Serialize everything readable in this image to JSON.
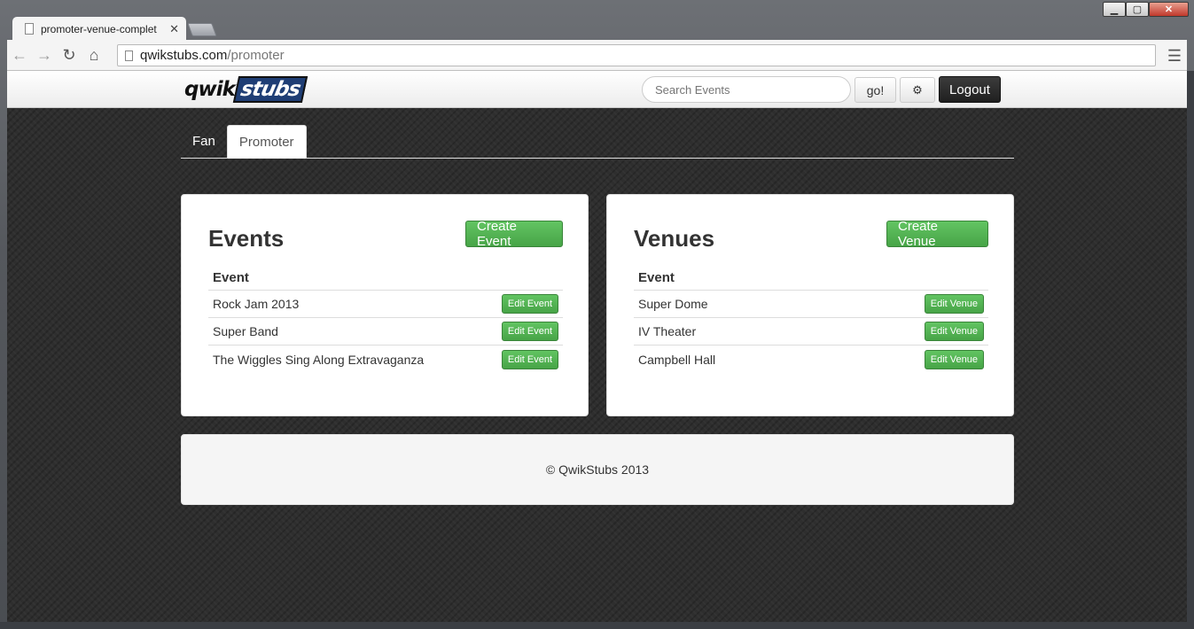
{
  "browser": {
    "tab_title": "promoter-venue-complet",
    "tab_close": "✕",
    "url_host": "qwikstubs.com",
    "url_path": "/promoter",
    "window_controls": {
      "minimize": "▁",
      "maximize": "▢",
      "close": "✕"
    }
  },
  "navbar": {
    "logo_part1": "qwik",
    "logo_part2": "stubs",
    "search_placeholder": "Search Events",
    "go_label": "go!",
    "settings_icon": "gear-icon",
    "logout_label": "Logout"
  },
  "page_tabs": [
    {
      "label": "Fan",
      "active": false
    },
    {
      "label": "Promoter",
      "active": true
    }
  ],
  "events_card": {
    "title": "Events",
    "create_label": "Create Event",
    "column_header": "Event",
    "rows": [
      {
        "name": "Rock Jam 2013",
        "action": "Edit Event"
      },
      {
        "name": "Super Band",
        "action": "Edit Event"
      },
      {
        "name": "The Wiggles Sing Along Extravaganza",
        "action": "Edit Event"
      }
    ]
  },
  "venues_card": {
    "title": "Venues",
    "create_label": "Create Venue",
    "column_header": "Event",
    "rows": [
      {
        "name": "Super Dome",
        "action": "Edit Venue"
      },
      {
        "name": "IV Theater",
        "action": "Edit Venue"
      },
      {
        "name": "Campbell Hall",
        "action": "Edit Venue"
      }
    ]
  },
  "footer": {
    "text": "© QwikStubs 2013"
  },
  "colors": {
    "success": "#5cb85c",
    "logo_blue": "#1f3e75",
    "logout_bg": "#222222"
  }
}
